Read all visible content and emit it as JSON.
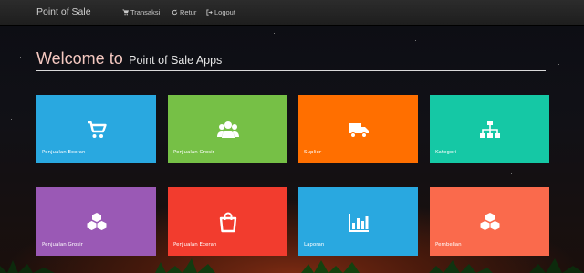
{
  "navbar": {
    "brand": "Point of Sale",
    "items": [
      {
        "label": "Transaksi",
        "icon": "cart-icon"
      },
      {
        "label": "Retur",
        "icon": "refresh-icon"
      },
      {
        "label": "Logout",
        "icon": "logout-icon"
      }
    ]
  },
  "heading": {
    "welcome": "Welcome to",
    "app_name": "Point of Sale Apps"
  },
  "tiles": [
    {
      "label": "Penjualan Eceran",
      "icon": "cart-icon",
      "color": "#29a8e0"
    },
    {
      "label": "Penjualan Grosir",
      "icon": "users-icon",
      "color": "#76c046"
    },
    {
      "label": "Suplier",
      "icon": "truck-icon",
      "color": "#ff6f00"
    },
    {
      "label": "Kategori",
      "icon": "sitemap-icon",
      "color": "#15c8a5"
    },
    {
      "label": "Penjualan Grosir",
      "icon": "cubes-icon",
      "color": "#9a59b5"
    },
    {
      "label": "Penjualan Eceran",
      "icon": "shopping-bag-icon",
      "color": "#f23c2e"
    },
    {
      "label": "Laporan",
      "icon": "bar-chart-icon",
      "color": "#29a8e0"
    },
    {
      "label": "Pembelian",
      "icon": "cubes-icon",
      "color": "#fa6a4c"
    }
  ]
}
